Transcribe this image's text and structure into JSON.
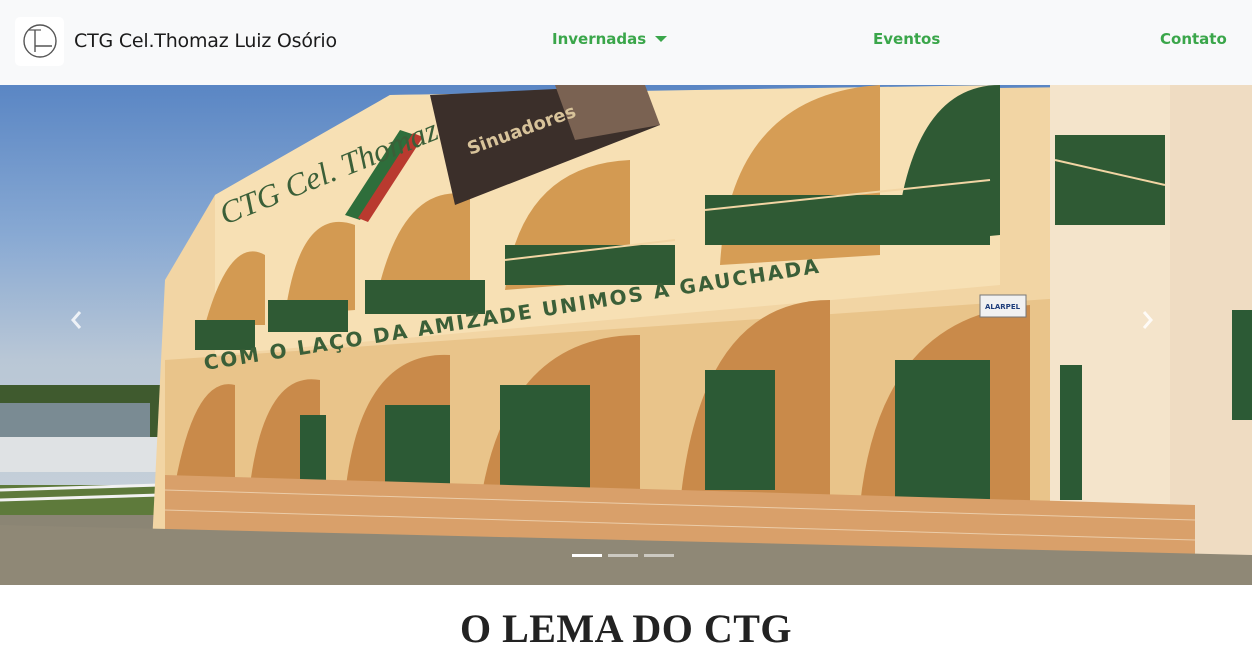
{
  "navbar": {
    "brand_name": "CTG Cel.Thomaz Luiz Osório",
    "links": [
      {
        "label": "Invernadas",
        "has_dropdown": true
      },
      {
        "label": "Eventos"
      },
      {
        "label": "Contato"
      }
    ],
    "link_color": "#3aa64a"
  },
  "carousel": {
    "slide_count": 3,
    "active_index": 0,
    "prev_icon": "chevron-left-icon",
    "next_icon": "chevron-right-icon",
    "photo_text": {
      "building_sign": "CTG Cel. Thomaz",
      "motto": "COM O LAÇO DA AMIZADE UNIMOS A GAUCHADA",
      "banner": "Sinuadores",
      "plaque": "ALARPEL"
    }
  },
  "section": {
    "title": "O LEMA DO CTG"
  }
}
